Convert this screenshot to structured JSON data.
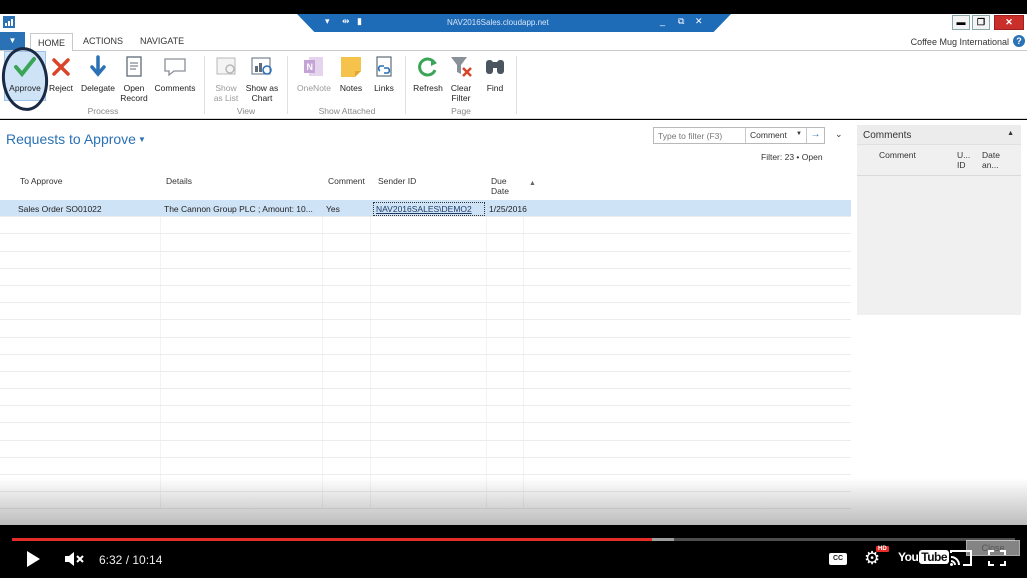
{
  "window": {
    "remote_title": "NAV2016Sales.cloudapp.net",
    "minimize": "▬",
    "maximize": "❐",
    "close": "✕"
  },
  "ribbon_tabs": {
    "home": "HOME",
    "actions": "ACTIONS",
    "navigate": "NAVIGATE",
    "company": "Coffee Mug International",
    "help": "?"
  },
  "ribbon": {
    "process": {
      "label": "Process",
      "approve": "Approve",
      "reject": "Reject",
      "delegate": "Delegate",
      "open_record_1": "Open",
      "open_record_2": "Record",
      "comments": "Comments"
    },
    "view": {
      "label": "View",
      "show_as_list_1": "Show",
      "show_as_list_2": "as List",
      "show_as_chart_1": "Show as",
      "show_as_chart_2": "Chart"
    },
    "show_attached": {
      "label": "Show Attached",
      "onenote": "OneNote",
      "notes": "Notes",
      "links": "Links"
    },
    "page": {
      "label": "Page",
      "refresh": "Refresh",
      "clear_filter_1": "Clear",
      "clear_filter_2": "Filter",
      "find": "Find"
    }
  },
  "page": {
    "title": "Requests to Approve",
    "filter_placeholder": "Type to filter (F3)",
    "filter_field": "Comment",
    "filter_status": "Filter: 23 • Open"
  },
  "grid": {
    "columns": {
      "to_approve": "To Approve",
      "details": "Details",
      "comment": "Comment",
      "sender_id": "Sender ID",
      "due_date_1": "Due",
      "due_date_2": "Date"
    },
    "rows": [
      {
        "to_approve": "Sales Order SO01022",
        "details": "The Cannon Group PLC ; Amount: 10...",
        "comment": "Yes",
        "sender_id": "NAV2016SALES\\DEMO2",
        "due_date": "1/25/2016"
      }
    ]
  },
  "factbox": {
    "title": "Comments",
    "col_comment": "Comment",
    "col_user_1": "U...",
    "col_user_2": "ID",
    "col_date_1": "Date",
    "col_date_2": "an..."
  },
  "video": {
    "time": "6:32 / 10:14",
    "progress_fraction": 0.638,
    "loaded_fraction": 0.66,
    "close_label": "Close",
    "hd": "HD",
    "youtube_you": "You",
    "youtube_tube": "Tube",
    "cc": "CC"
  },
  "colors": {
    "accent": "#2b71b5",
    "selection": "#cfe3f7",
    "progress": "#e52d27"
  }
}
